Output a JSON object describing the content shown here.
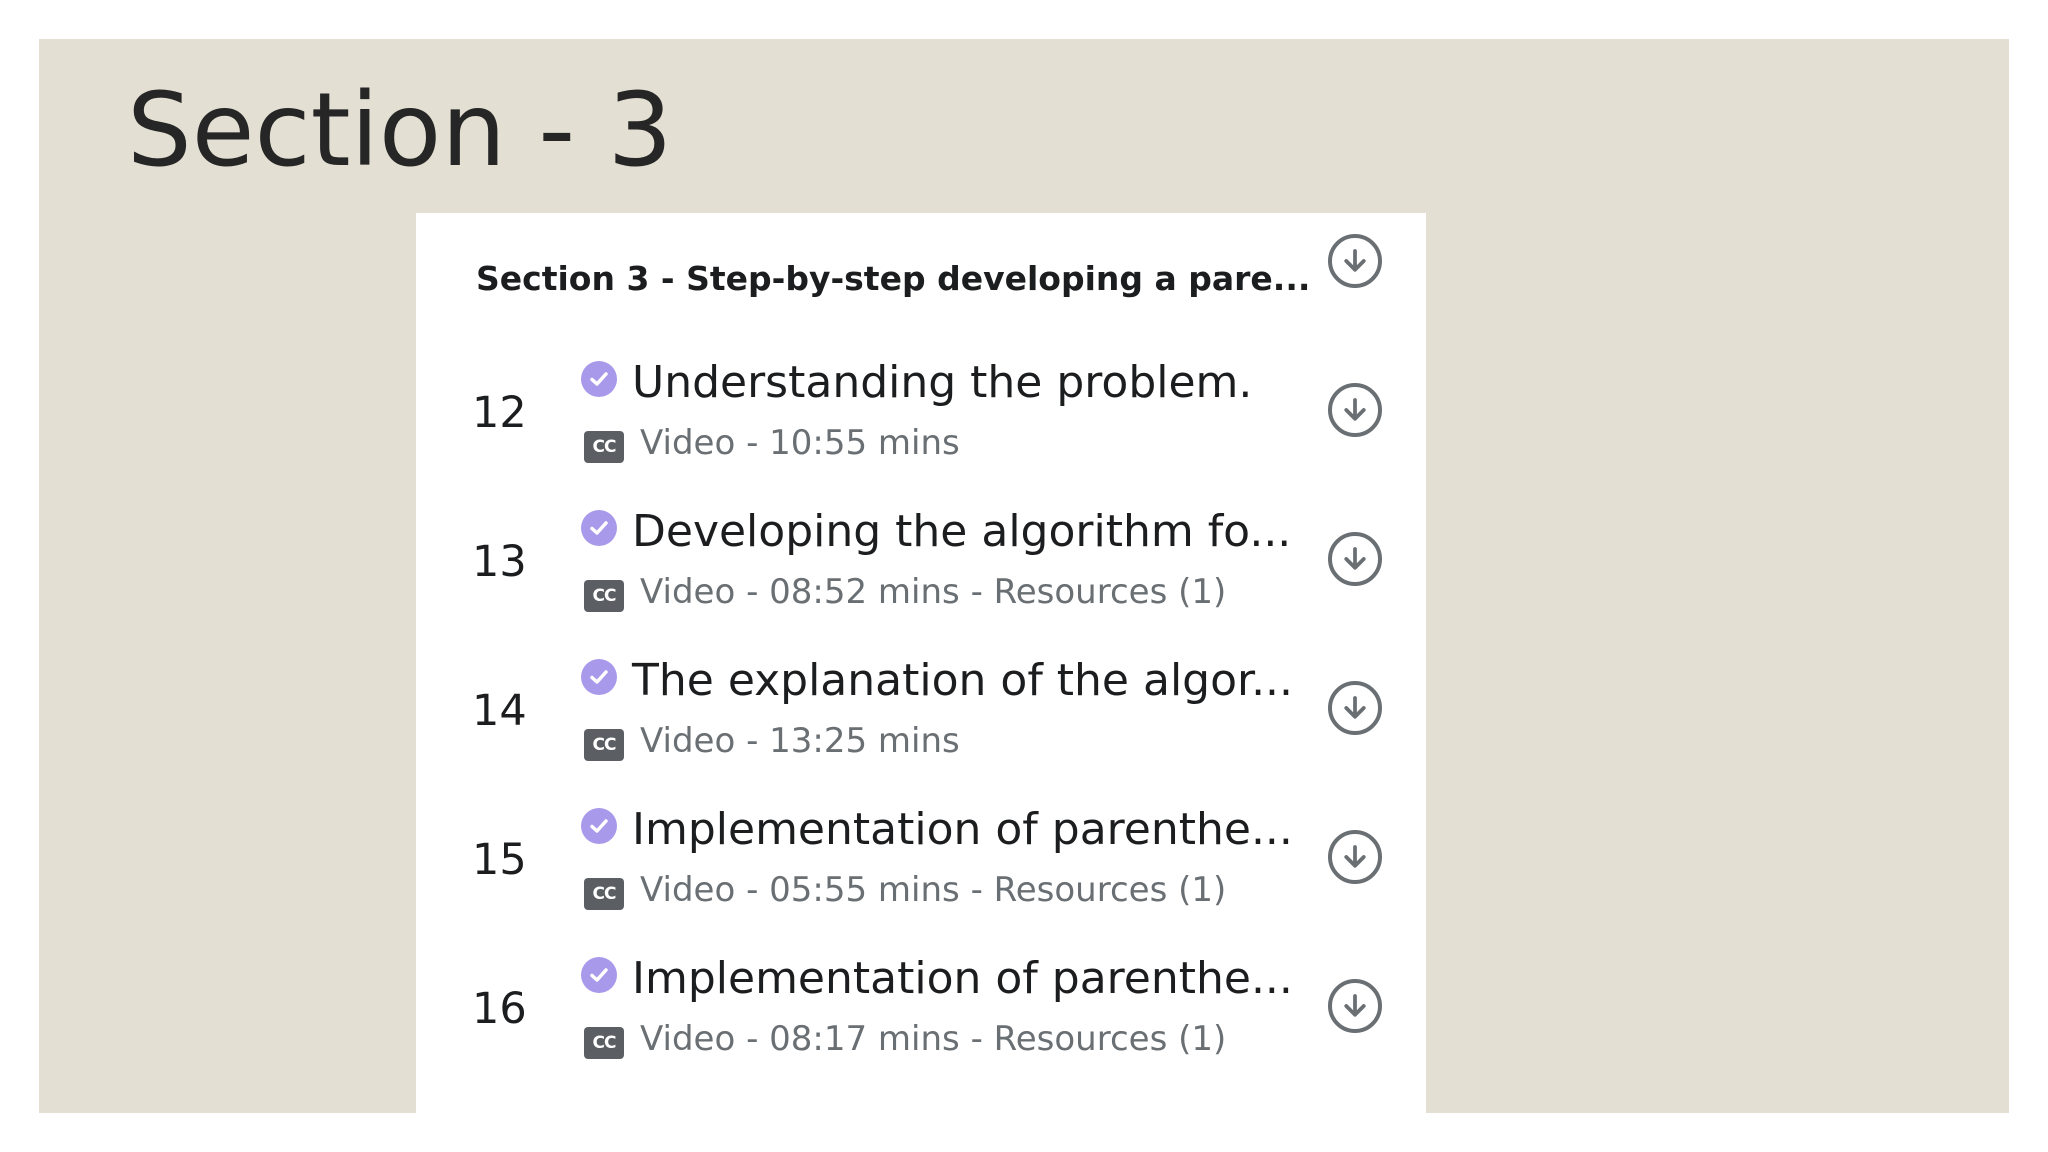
{
  "slide": {
    "title": "Section - 3"
  },
  "section": {
    "header": "Section 3 - Step-by-step developing a pare...",
    "header_icon": "download-icon",
    "lectures": [
      {
        "number": "12",
        "title": "Understanding the problem.",
        "cc": "CC",
        "meta": "Video - 10:55 mins"
      },
      {
        "number": "13",
        "title": "Developing the algorithm fo...",
        "cc": "CC",
        "meta": "Video - 08:52 mins - Resources (1)"
      },
      {
        "number": "14",
        "title": "The explanation of the algor...",
        "cc": "CC",
        "meta": "Video - 13:25 mins"
      },
      {
        "number": "15",
        "title": "Implementation of parenthe...",
        "cc": "CC",
        "meta": "Video - 05:55 mins - Resources (1)"
      },
      {
        "number": "16",
        "title": "Implementation of parenthe...",
        "cc": "CC",
        "meta": "Video - 08:17 mins - Resources (1)"
      }
    ]
  },
  "colors": {
    "slide_background": "#e3dfd2",
    "check_accent": "#a999ea",
    "icon_gray": "#6a6f73"
  }
}
